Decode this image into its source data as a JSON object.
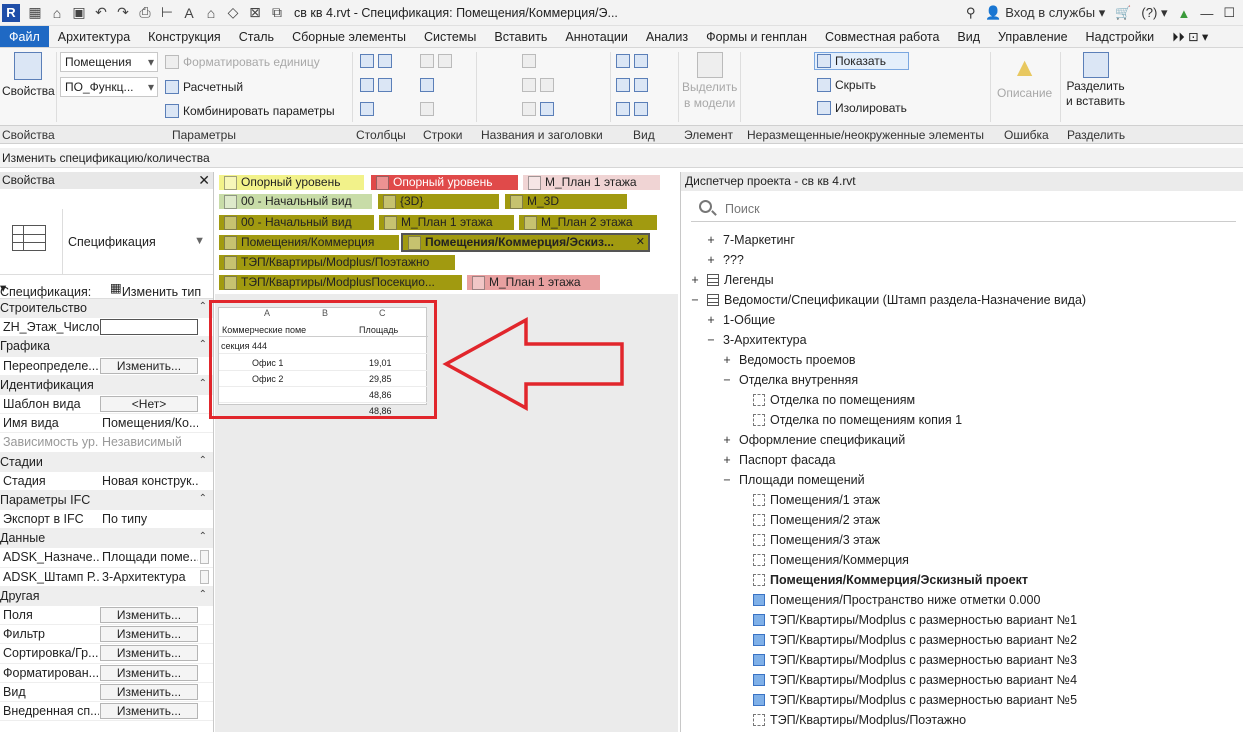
{
  "titlebar": {
    "title": "св кв 4.rvt - Спецификация: Помещения/Коммерция/Э...",
    "signin": "Вход в службы",
    "help": "?"
  },
  "tabs": [
    "Файл",
    "Архитектура",
    "Конструкция",
    "Сталь",
    "Сборные элементы",
    "Системы",
    "Вставить",
    "Аннотации",
    "Анализ",
    "Формы и генплан",
    "Совместная работа",
    "Вид",
    "Управление",
    "Надстройки"
  ],
  "ribbon": {
    "properties_btn": "Свойства",
    "combo_category": "Помещения",
    "combo_param": "ПО_Функц...",
    "format_unit": "Форматировать единицу",
    "calculated": "Расчетный",
    "combine": "Комбинировать параметры",
    "select_in_model_1": "Выделить",
    "select_in_model_2": "в модели",
    "show": "Показать",
    "hide": "Скрыть",
    "isolate": "Изолировать",
    "description": "Описание",
    "split_1": "Разделить",
    "split_2": "и вставить",
    "groups": {
      "properties": "Свойства",
      "params": "Параметры",
      "columns": "Столбцы",
      "rows": "Строки",
      "titles": "Названия и заголовки",
      "view": "Вид",
      "element": "Элемент",
      "unplaced": "Неразмещенные/неокруженные элементы",
      "error": "Ошибка",
      "split": "Разделить"
    }
  },
  "context": "Изменить спецификацию/количества",
  "properties": {
    "header": "Свойства",
    "type_name": "Спецификация",
    "spec_label": "Спецификация:",
    "edit_type": "Изменить тип",
    "rows": [
      {
        "cat": true,
        "k": "Строительство"
      },
      {
        "k": "ZH_Этаж_Число...",
        "input": true
      },
      {
        "cat": true,
        "k": "Графика"
      },
      {
        "k": "Переопределе...",
        "btn": "Изменить..."
      },
      {
        "cat": true,
        "k": "Идентификация"
      },
      {
        "k": "Шаблон вида",
        "btn": "<Нет>"
      },
      {
        "k": "Имя вида",
        "v": "Помещения/Ко..."
      },
      {
        "k": "Зависимость ур...",
        "v": "Независимый",
        "grey": true
      },
      {
        "cat": true,
        "k": "Стадии"
      },
      {
        "k": "Стадия",
        "v": "Новая конструк..."
      },
      {
        "cat": true,
        "k": "Параметры IFC"
      },
      {
        "k": "Экспорт в IFC",
        "v": "По типу"
      },
      {
        "cat": true,
        "k": "Данные"
      },
      {
        "k": "ADSK_Назначе...",
        "v": "Площади поме...",
        "sq": true
      },
      {
        "k": "ADSK_Штамп Р...",
        "v": "3-Архитектура",
        "sq": true
      },
      {
        "cat": true,
        "k": "Другая"
      },
      {
        "k": "Поля",
        "btn": "Изменить..."
      },
      {
        "k": "Фильтр",
        "btn": "Изменить..."
      },
      {
        "k": "Сортировка/Гр...",
        "btn": "Изменить..."
      },
      {
        "k": "Форматирован...",
        "btn": "Изменить..."
      },
      {
        "k": "Вид",
        "btn": "Изменить..."
      },
      {
        "k": "Внедренная сп...",
        "btn": "Изменить..."
      }
    ]
  },
  "view_tabs": [
    {
      "label": "Опорный уровень",
      "color": "#f2f28a"
    },
    {
      "label": "Опорный уровень",
      "color": "#e04a4a"
    },
    {
      "label": "М_План 1 этажа",
      "color": "#f0d4d4"
    },
    {
      "label": "00 - Начальный вид",
      "color": "#c8dca8"
    },
    {
      "label": "{3D}",
      "color": "#a19a10"
    },
    {
      "label": "М_3D",
      "color": "#a19a10"
    },
    {
      "label": "00 - Начальный вид",
      "color": "#a19a10"
    },
    {
      "label": "М_План 1 этажа",
      "color": "#a19a10"
    },
    {
      "label": "М_План 2 этажа",
      "color": "#a19a10"
    },
    {
      "label": "Помещения/Коммерция",
      "color": "#a19a10"
    },
    {
      "label": "Помещения/Коммерция/Эскиз...",
      "color": "#a19a10"
    },
    {
      "label": "ТЭП/Квартиры/Modplus/Поэтажно",
      "color": "#a19a10"
    },
    {
      "label": "ТЭП/Квартиры/ModplusПосекцио...",
      "color": "#a19a10"
    },
    {
      "label": "М_План 1 этажа",
      "color": "#e8a0a0"
    }
  ],
  "schedule": {
    "col_a": "A",
    "col_b": "B",
    "col_c": "C",
    "h1": "Коммерческие поме",
    "h2": "Площадь",
    "section": "секция 444",
    "rows": [
      {
        "name": "Офис 1",
        "area": "19,01"
      },
      {
        "name": "Офис 2",
        "area": "29,85"
      },
      {
        "name": "",
        "area": "48,86"
      },
      {
        "name": "",
        "area": "48,86"
      }
    ]
  },
  "browser": {
    "header": "Диспетчер проекта - св кв 4.rvt",
    "search_placeholder": "Поиск",
    "nodes": [
      {
        "label": "7-Маркетинг",
        "tg": "+",
        "indent": 1
      },
      {
        "label": "???",
        "tg": "+",
        "indent": 1
      },
      {
        "label": "Легенды",
        "tg": "+",
        "indent": 0,
        "icon": "tbl"
      },
      {
        "label": "Ведомости/Спецификации (Штамп раздела-Назначение вида)",
        "tg": "−",
        "indent": 0,
        "icon": "tbl"
      },
      {
        "label": "1-Общие",
        "tg": "+",
        "indent": 1
      },
      {
        "label": "3-Архитектура",
        "tg": "−",
        "indent": 1
      },
      {
        "label": "Ведомость проемов",
        "tg": "+",
        "indent": 2
      },
      {
        "label": "Отделка внутренняя",
        "tg": "−",
        "indent": 2
      },
      {
        "label": "Отделка по помещениям",
        "indent": 3,
        "icon": "dash"
      },
      {
        "label": "Отделка по помещениям копия 1",
        "indent": 3,
        "icon": "dash"
      },
      {
        "label": "Оформление спецификаций",
        "tg": "+",
        "indent": 2
      },
      {
        "label": "Паспорт фасада",
        "tg": "+",
        "indent": 2
      },
      {
        "label": "Площади помещений",
        "tg": "−",
        "indent": 2
      },
      {
        "label": "Помещения/1 этаж",
        "indent": 3,
        "icon": "dash"
      },
      {
        "label": "Помещения/2 этаж",
        "indent": 3,
        "icon": "dash"
      },
      {
        "label": "Помещения/3 этаж",
        "indent": 3,
        "icon": "dash"
      },
      {
        "label": "Помещения/Коммерция",
        "indent": 3,
        "icon": "dash"
      },
      {
        "label": "Помещения/Коммерция/Эскизный проект",
        "indent": 3,
        "icon": "dash",
        "bold": true
      },
      {
        "label": "Помещения/Пространство ниже отметки 0.000",
        "indent": 3,
        "icon": "blue"
      },
      {
        "label": "ТЭП/Квартиры/Modplus с размерностью вариант №1",
        "indent": 3,
        "icon": "blue"
      },
      {
        "label": "ТЭП/Квартиры/Modplus с размерностью вариант №2",
        "indent": 3,
        "icon": "blue"
      },
      {
        "label": "ТЭП/Квартиры/Modplus с размерностью вариант №3",
        "indent": 3,
        "icon": "blue"
      },
      {
        "label": "ТЭП/Квартиры/Modplus с размерностью вариант №4",
        "indent": 3,
        "icon": "blue"
      },
      {
        "label": "ТЭП/Квартиры/Modplus с размерностью вариант №5",
        "indent": 3,
        "icon": "blue"
      },
      {
        "label": "ТЭП/Квартиры/Modplus/Поэтажно",
        "indent": 3,
        "icon": "dash"
      }
    ]
  },
  "colors": {
    "accent": "#1f69c4",
    "highlight": "#e1262c"
  }
}
